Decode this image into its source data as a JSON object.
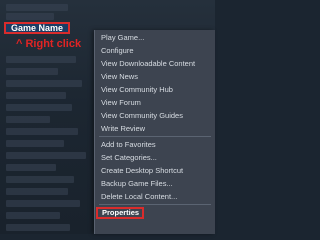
{
  "library": {
    "selected_game": "Game Name"
  },
  "annotation": "^ Right click",
  "context_menu": {
    "items": [
      "Play Game...",
      "Configure",
      "View Downloadable Content",
      "View News",
      "View Community Hub",
      "View Forum",
      "View Community Guides",
      "Write Review",
      "Add to Favorites",
      "Set Categories...",
      "Create Desktop Shortcut",
      "Backup Game Files...",
      "Delete Local Content...",
      "Properties"
    ]
  },
  "colors": {
    "highlight_border": "#d92c2c",
    "annotation_text": "#e02424",
    "menu_background": "#3d4450",
    "selected_row": "#1b3b63"
  }
}
